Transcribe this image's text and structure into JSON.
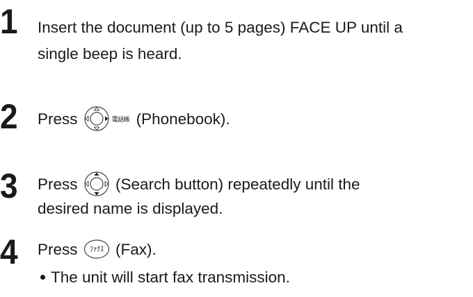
{
  "steps": [
    {
      "number": "1",
      "line1": "Insert the document (up to 5 pages) FACE UP until a",
      "line2": "single beep is heard."
    },
    {
      "number": "2",
      "before": "Press",
      "icon_label": "電話帳",
      "after": "(Phonebook)."
    },
    {
      "number": "3",
      "before": "Press",
      "after": "(Search button) repeatedly until the",
      "line2": "desired name is displayed."
    },
    {
      "number": "4",
      "before": "Press",
      "icon_label": "ﾌｧｸｽ",
      "after": "(Fax).",
      "bullet": "The unit will start fax transmission."
    }
  ],
  "icons": {
    "step2": "navigator-right-icon",
    "step3": "navigator-up-down-icon",
    "step4": "fax-button-icon"
  }
}
